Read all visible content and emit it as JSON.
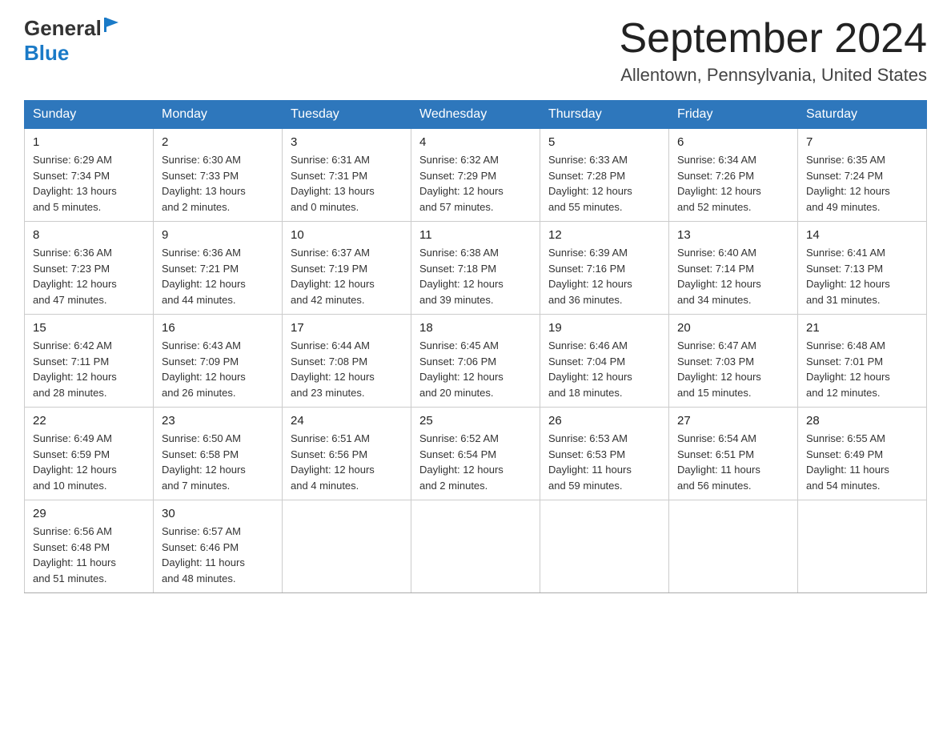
{
  "header": {
    "logo_general": "General",
    "logo_blue": "Blue",
    "month_year": "September 2024",
    "location": "Allentown, Pennsylvania, United States"
  },
  "weekdays": [
    "Sunday",
    "Monday",
    "Tuesday",
    "Wednesday",
    "Thursday",
    "Friday",
    "Saturday"
  ],
  "weeks": [
    [
      {
        "day": "1",
        "sunrise": "6:29 AM",
        "sunset": "7:34 PM",
        "daylight": "13 hours and 5 minutes."
      },
      {
        "day": "2",
        "sunrise": "6:30 AM",
        "sunset": "7:33 PM",
        "daylight": "13 hours and 2 minutes."
      },
      {
        "day": "3",
        "sunrise": "6:31 AM",
        "sunset": "7:31 PM",
        "daylight": "13 hours and 0 minutes."
      },
      {
        "day": "4",
        "sunrise": "6:32 AM",
        "sunset": "7:29 PM",
        "daylight": "12 hours and 57 minutes."
      },
      {
        "day": "5",
        "sunrise": "6:33 AM",
        "sunset": "7:28 PM",
        "daylight": "12 hours and 55 minutes."
      },
      {
        "day": "6",
        "sunrise": "6:34 AM",
        "sunset": "7:26 PM",
        "daylight": "12 hours and 52 minutes."
      },
      {
        "day": "7",
        "sunrise": "6:35 AM",
        "sunset": "7:24 PM",
        "daylight": "12 hours and 49 minutes."
      }
    ],
    [
      {
        "day": "8",
        "sunrise": "6:36 AM",
        "sunset": "7:23 PM",
        "daylight": "12 hours and 47 minutes."
      },
      {
        "day": "9",
        "sunrise": "6:36 AM",
        "sunset": "7:21 PM",
        "daylight": "12 hours and 44 minutes."
      },
      {
        "day": "10",
        "sunrise": "6:37 AM",
        "sunset": "7:19 PM",
        "daylight": "12 hours and 42 minutes."
      },
      {
        "day": "11",
        "sunrise": "6:38 AM",
        "sunset": "7:18 PM",
        "daylight": "12 hours and 39 minutes."
      },
      {
        "day": "12",
        "sunrise": "6:39 AM",
        "sunset": "7:16 PM",
        "daylight": "12 hours and 36 minutes."
      },
      {
        "day": "13",
        "sunrise": "6:40 AM",
        "sunset": "7:14 PM",
        "daylight": "12 hours and 34 minutes."
      },
      {
        "day": "14",
        "sunrise": "6:41 AM",
        "sunset": "7:13 PM",
        "daylight": "12 hours and 31 minutes."
      }
    ],
    [
      {
        "day": "15",
        "sunrise": "6:42 AM",
        "sunset": "7:11 PM",
        "daylight": "12 hours and 28 minutes."
      },
      {
        "day": "16",
        "sunrise": "6:43 AM",
        "sunset": "7:09 PM",
        "daylight": "12 hours and 26 minutes."
      },
      {
        "day": "17",
        "sunrise": "6:44 AM",
        "sunset": "7:08 PM",
        "daylight": "12 hours and 23 minutes."
      },
      {
        "day": "18",
        "sunrise": "6:45 AM",
        "sunset": "7:06 PM",
        "daylight": "12 hours and 20 minutes."
      },
      {
        "day": "19",
        "sunrise": "6:46 AM",
        "sunset": "7:04 PM",
        "daylight": "12 hours and 18 minutes."
      },
      {
        "day": "20",
        "sunrise": "6:47 AM",
        "sunset": "7:03 PM",
        "daylight": "12 hours and 15 minutes."
      },
      {
        "day": "21",
        "sunrise": "6:48 AM",
        "sunset": "7:01 PM",
        "daylight": "12 hours and 12 minutes."
      }
    ],
    [
      {
        "day": "22",
        "sunrise": "6:49 AM",
        "sunset": "6:59 PM",
        "daylight": "12 hours and 10 minutes."
      },
      {
        "day": "23",
        "sunrise": "6:50 AM",
        "sunset": "6:58 PM",
        "daylight": "12 hours and 7 minutes."
      },
      {
        "day": "24",
        "sunrise": "6:51 AM",
        "sunset": "6:56 PM",
        "daylight": "12 hours and 4 minutes."
      },
      {
        "day": "25",
        "sunrise": "6:52 AM",
        "sunset": "6:54 PM",
        "daylight": "12 hours and 2 minutes."
      },
      {
        "day": "26",
        "sunrise": "6:53 AM",
        "sunset": "6:53 PM",
        "daylight": "11 hours and 59 minutes."
      },
      {
        "day": "27",
        "sunrise": "6:54 AM",
        "sunset": "6:51 PM",
        "daylight": "11 hours and 56 minutes."
      },
      {
        "day": "28",
        "sunrise": "6:55 AM",
        "sunset": "6:49 PM",
        "daylight": "11 hours and 54 minutes."
      }
    ],
    [
      {
        "day": "29",
        "sunrise": "6:56 AM",
        "sunset": "6:48 PM",
        "daylight": "11 hours and 51 minutes."
      },
      {
        "day": "30",
        "sunrise": "6:57 AM",
        "sunset": "6:46 PM",
        "daylight": "11 hours and 48 minutes."
      },
      null,
      null,
      null,
      null,
      null
    ]
  ],
  "labels": {
    "sunrise": "Sunrise:",
    "sunset": "Sunset:",
    "daylight": "Daylight:"
  }
}
